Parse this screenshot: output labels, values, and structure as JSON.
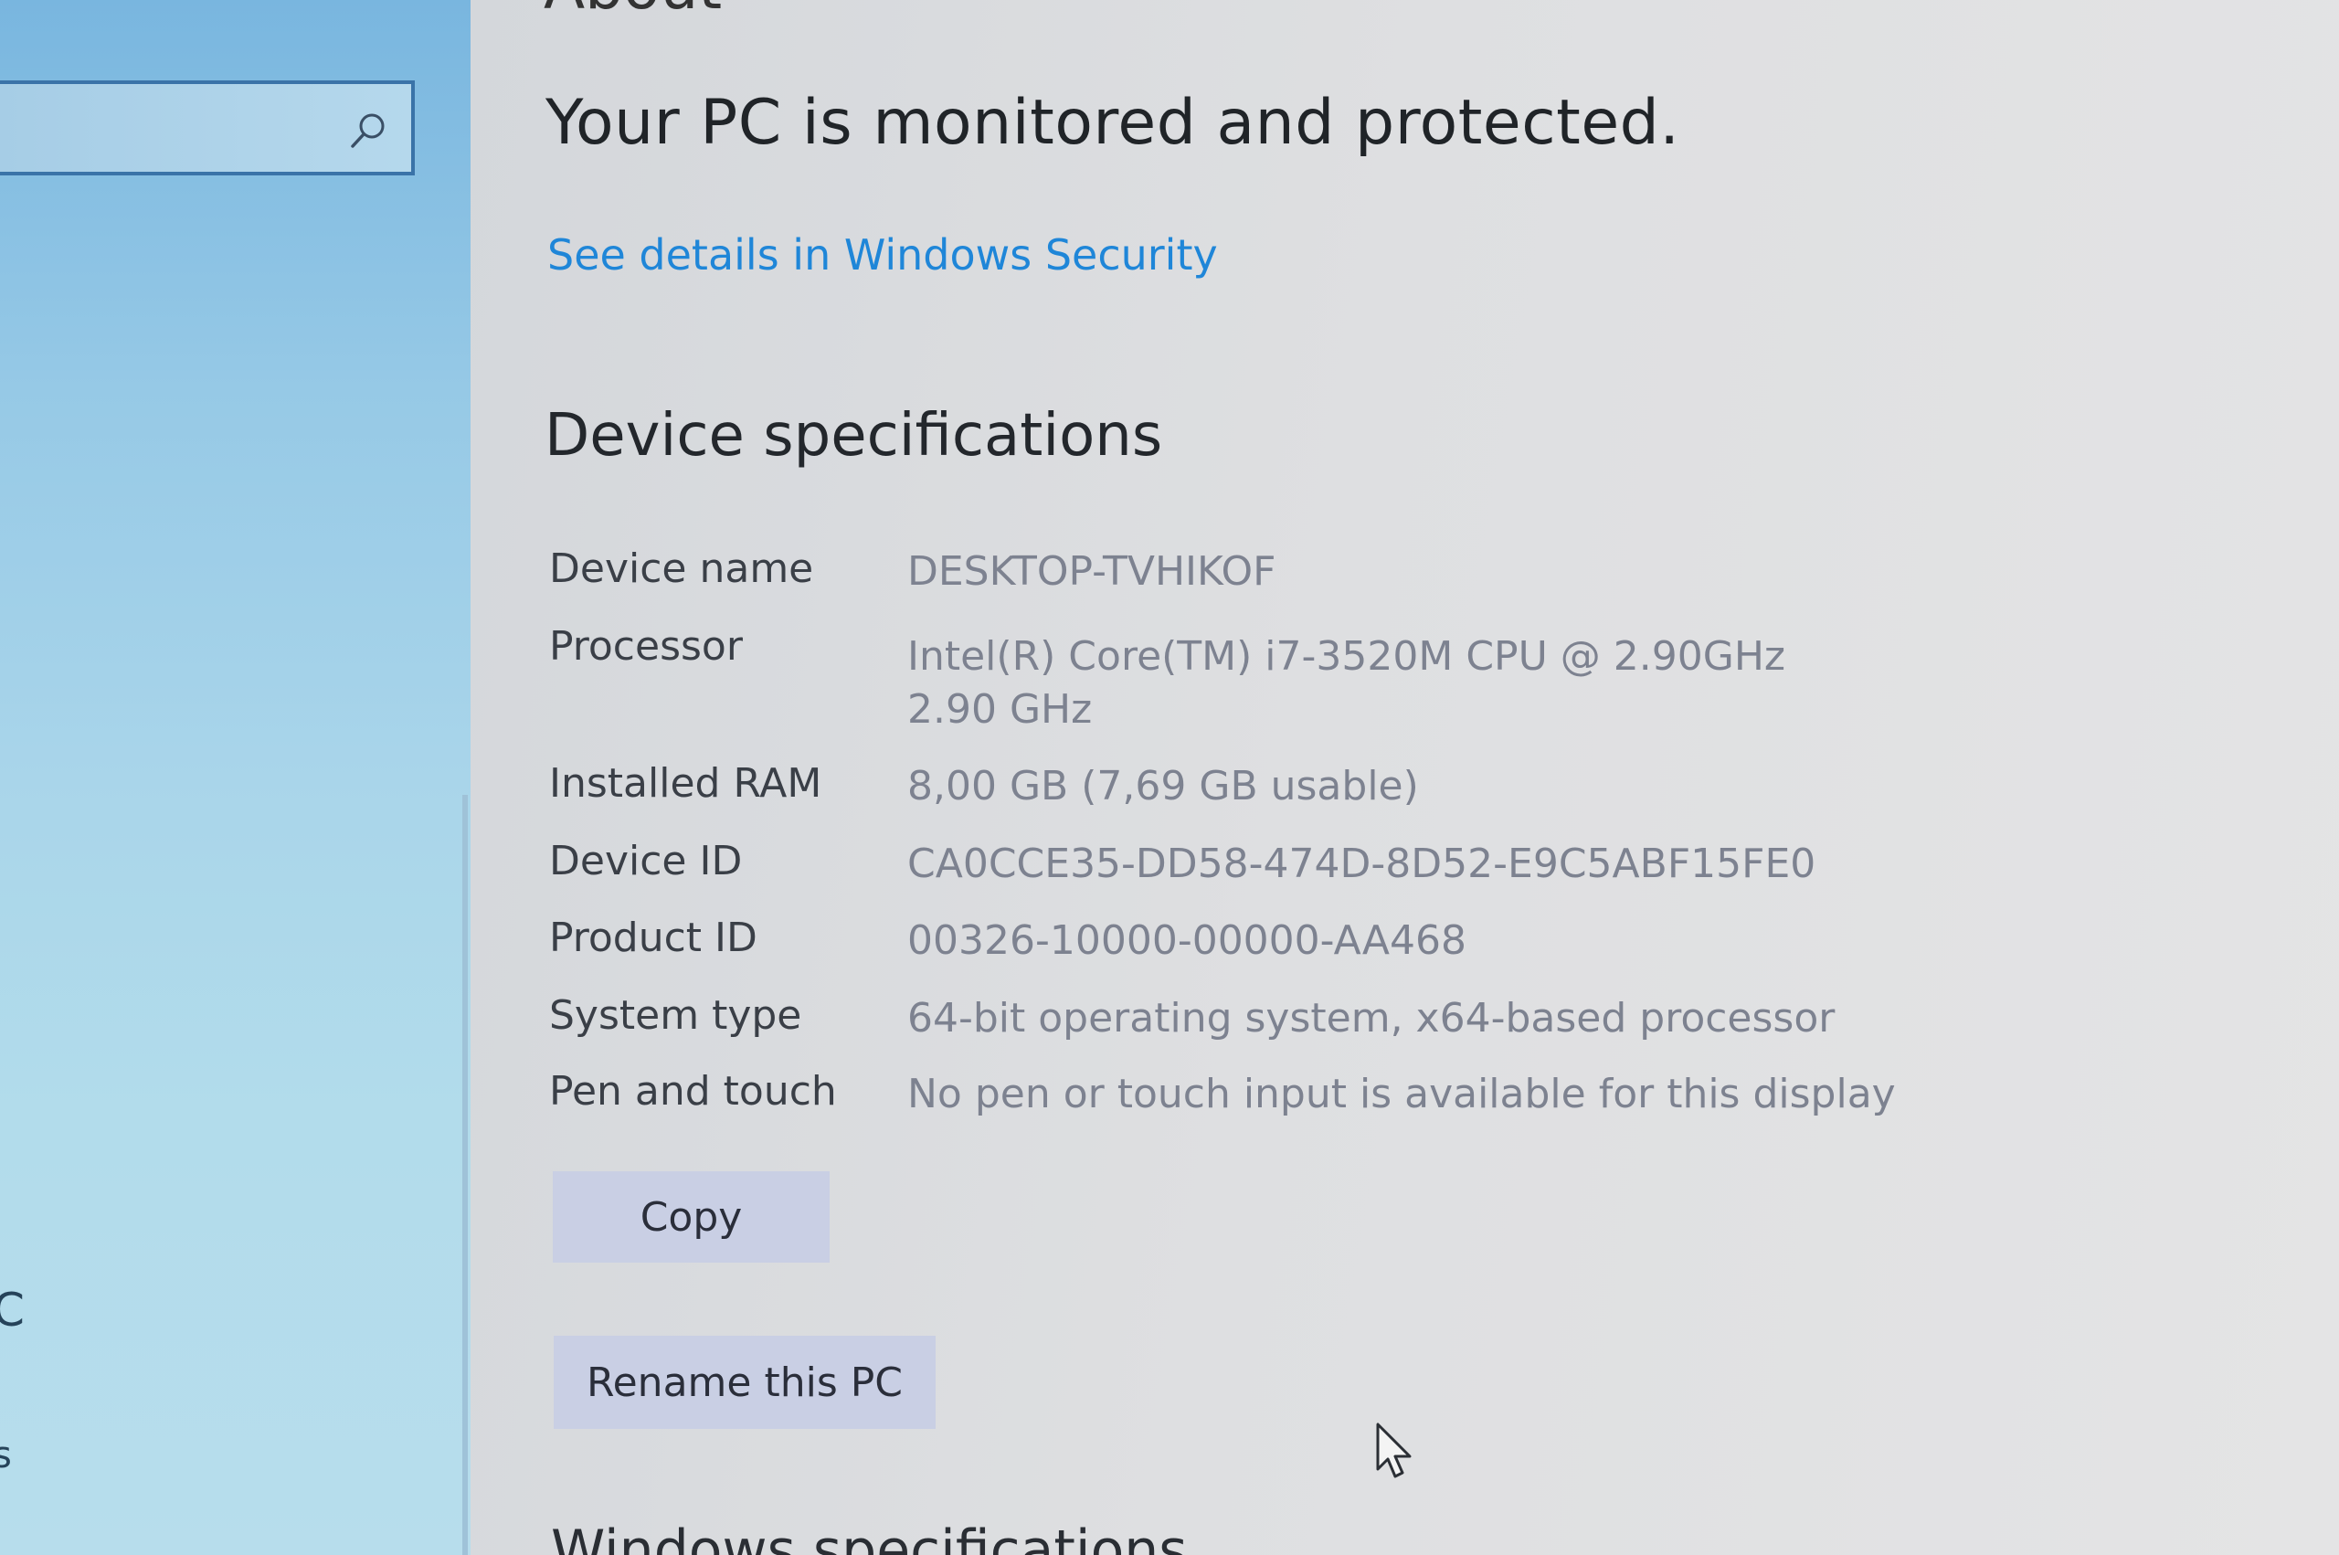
{
  "page": {
    "heading_partial": "About",
    "protection_status": "Your PC is monitored and protected.",
    "security_link": "See details in Windows Security"
  },
  "sidebar": {
    "search_icon": "search-icon",
    "fragment_1": "C",
    "fragment_2": "s"
  },
  "device_specs": {
    "title": "Device specifications",
    "rows": [
      {
        "label": "Device name",
        "value": "DESKTOP-TVHIKOF"
      },
      {
        "label": "Processor",
        "value": "Intel(R) Core(TM) i7-3520M CPU @ 2.90GHz   2.90 GHz"
      },
      {
        "label": "Installed RAM",
        "value": "8,00 GB (7,69 GB usable)"
      },
      {
        "label": "Device ID",
        "value": "CA0CCE35-DD58-474D-8D52-E9C5ABF15FE0"
      },
      {
        "label": "Product ID",
        "value": "00326-10000-00000-AA468"
      },
      {
        "label": "System type",
        "value": "64-bit operating system, x64-based processor"
      },
      {
        "label": "Pen and touch",
        "value": "No pen or touch input is available for this display"
      }
    ],
    "copy_label": "Copy",
    "rename_label": "Rename this PC"
  },
  "windows_specs": {
    "title": "Windows specifications"
  },
  "colors": {
    "accent_link": "#1f86d8",
    "button_bg": "#c9cfe4"
  },
  "icons": {
    "cursor": "mouse-pointer-icon"
  }
}
